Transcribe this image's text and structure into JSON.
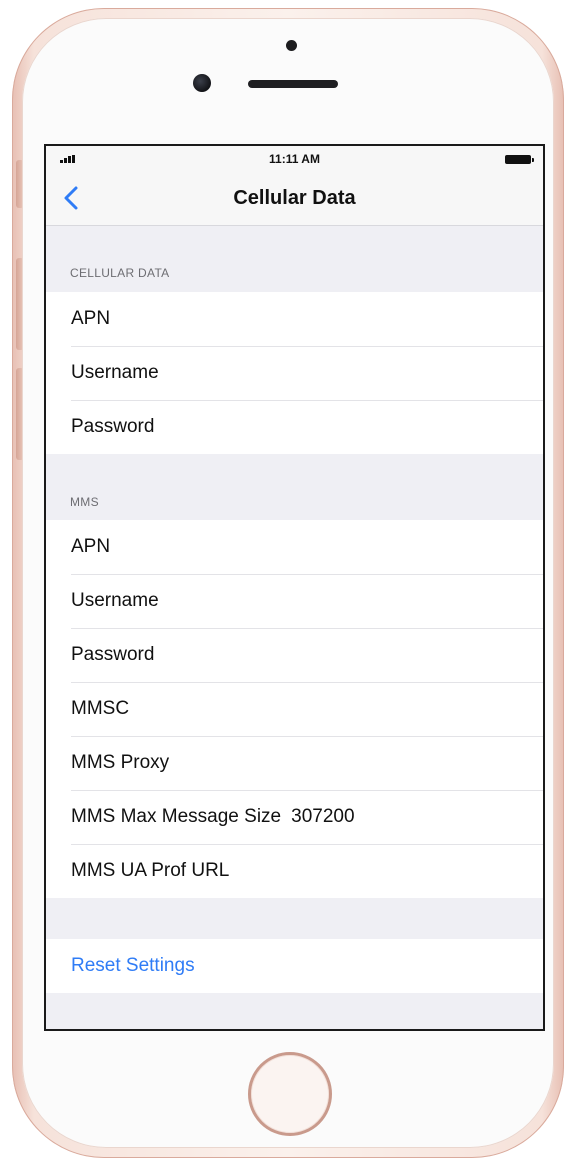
{
  "status_bar": {
    "time": "11:11 AM"
  },
  "nav": {
    "title": "Cellular Data",
    "back_icon": "chevron-left-icon"
  },
  "sections": {
    "cellular": {
      "header": "CELLULAR DATA",
      "rows": [
        {
          "label": "APN",
          "value": ""
        },
        {
          "label": "Username",
          "value": ""
        },
        {
          "label": "Password",
          "value": ""
        }
      ]
    },
    "mms": {
      "header": "MMS",
      "rows": [
        {
          "label": "APN",
          "value": ""
        },
        {
          "label": "Username",
          "value": ""
        },
        {
          "label": "Password",
          "value": ""
        },
        {
          "label": "MMSC",
          "value": ""
        },
        {
          "label": "MMS Proxy",
          "value": ""
        },
        {
          "label": "MMS Max Message Size",
          "value": "307200"
        },
        {
          "label": "MMS UA Prof URL",
          "value": ""
        }
      ]
    }
  },
  "reset": {
    "label": "Reset Settings"
  },
  "colors": {
    "accent": "#2f7cf6",
    "grouped_background": "#efeff4",
    "phone_frame": "#e7bfb3"
  }
}
